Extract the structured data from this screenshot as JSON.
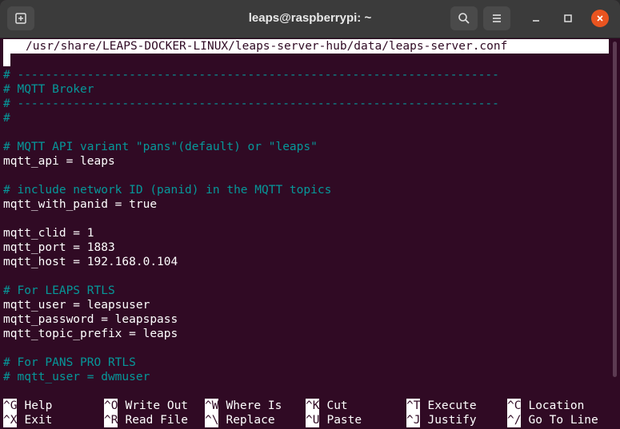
{
  "window": {
    "title": "leaps@raspberrypi: ~",
    "icons": {
      "new_tab": "new-tab-icon",
      "search": "search-icon",
      "menu": "hamburger-menu-icon",
      "minimize": "minimize-icon",
      "maximize": "maximize-icon",
      "close": "close-icon"
    },
    "colors": {
      "terminal_bg": "#300a24",
      "comment": "#06989a",
      "close_button": "#e95420"
    }
  },
  "editor": {
    "filename": "/usr/share/LEAPS-DOCKER-LINUX/leaps-server-hub/data/leaps-server.conf",
    "lines": [
      {
        "text": "# ---------------------------------------------------------------------",
        "type": "comment"
      },
      {
        "text": "# MQTT Broker",
        "type": "comment"
      },
      {
        "text": "# ---------------------------------------------------------------------",
        "type": "comment"
      },
      {
        "text": "#",
        "type": "comment"
      },
      {
        "text": "",
        "type": "text"
      },
      {
        "text": "# MQTT API variant \"pans\"(default) or \"leaps\"",
        "type": "comment"
      },
      {
        "text": "mqtt_api = leaps",
        "type": "text"
      },
      {
        "text": "",
        "type": "text"
      },
      {
        "text": "# include network ID (panid) in the MQTT topics",
        "type": "comment"
      },
      {
        "text": "mqtt_with_panid = true",
        "type": "text"
      },
      {
        "text": "",
        "type": "text"
      },
      {
        "text": "mqtt_clid = 1",
        "type": "text"
      },
      {
        "text": "mqtt_port = 1883",
        "type": "text"
      },
      {
        "text": "mqtt_host = 192.168.0.104",
        "type": "text"
      },
      {
        "text": "",
        "type": "text"
      },
      {
        "text": "# For LEAPS RTLS",
        "type": "comment"
      },
      {
        "text": "mqtt_user = leapsuser",
        "type": "text"
      },
      {
        "text": "mqtt_password = leapspass",
        "type": "text"
      },
      {
        "text": "mqtt_topic_prefix = leaps",
        "type": "text"
      },
      {
        "text": "",
        "type": "text"
      },
      {
        "text": "# For PANS PRO RTLS",
        "type": "comment"
      },
      {
        "text": "# mqtt_user = dwmuser",
        "type": "comment"
      }
    ]
  },
  "shortcuts": [
    {
      "key": "^G",
      "label": "Help"
    },
    {
      "key": "^O",
      "label": "Write Out"
    },
    {
      "key": "^W",
      "label": "Where Is"
    },
    {
      "key": "^K",
      "label": "Cut"
    },
    {
      "key": "^T",
      "label": "Execute"
    },
    {
      "key": "^C",
      "label": "Location"
    },
    {
      "key": "^X",
      "label": "Exit"
    },
    {
      "key": "^R",
      "label": "Read File"
    },
    {
      "key": "^\\",
      "label": "Replace"
    },
    {
      "key": "^U",
      "label": "Paste"
    },
    {
      "key": "^J",
      "label": "Justify"
    },
    {
      "key": "^/",
      "label": "Go To Line"
    }
  ]
}
